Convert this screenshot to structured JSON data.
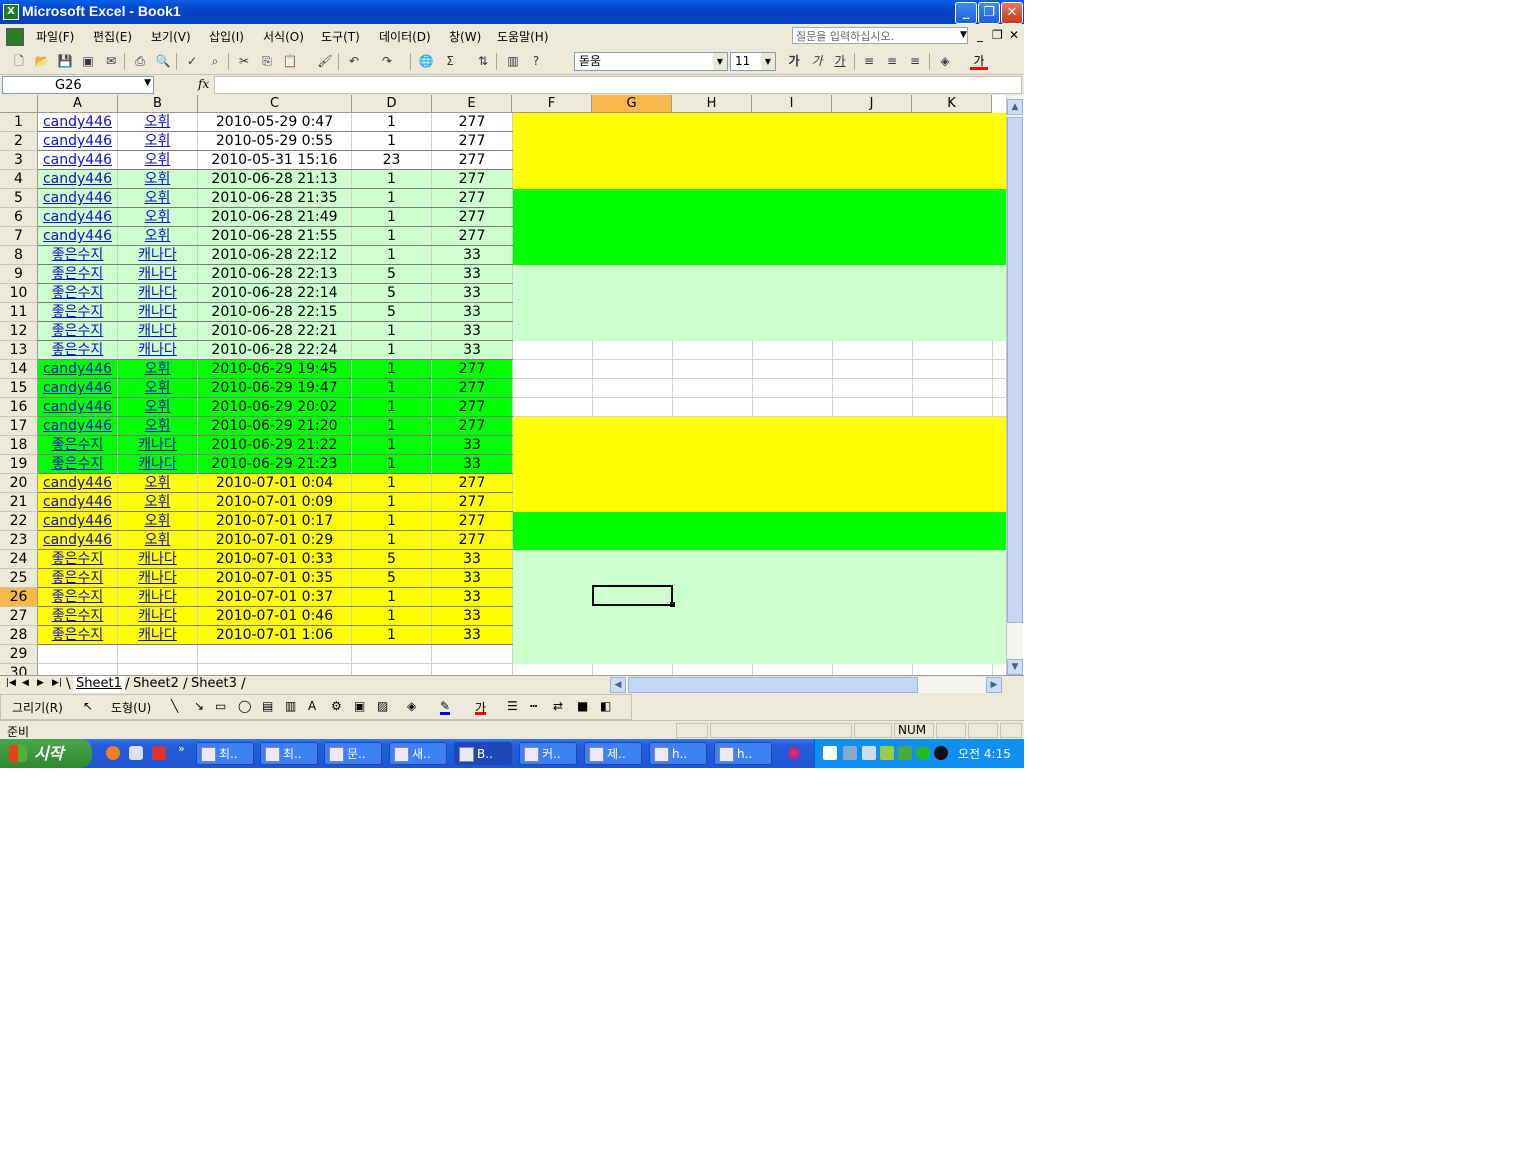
{
  "window": {
    "title": "Microsoft Excel - Book1"
  },
  "menu": {
    "items": [
      "파일(F)",
      "편집(E)",
      "보기(V)",
      "삽입(I)",
      "서식(O)",
      "도구(T)",
      "데이터(D)",
      "창(W)",
      "도움말(H)"
    ],
    "help_placeholder": "질문을 입력하십시오."
  },
  "format": {
    "font": "돋움",
    "size": "11",
    "bold": "가",
    "italic": "가",
    "underline": "가",
    "font_color": "가"
  },
  "formula_bar": {
    "name_box": "G26",
    "fx": "fx",
    "value": ""
  },
  "columns": [
    "A",
    "B",
    "C",
    "D",
    "E",
    "F",
    "G",
    "H",
    "I",
    "J",
    "K"
  ],
  "selected_column": "G",
  "selected_row": "26",
  "rows": [
    {
      "n": "1",
      "a": "candy446",
      "b": "오휘",
      "c": "2010-05-29 0:47",
      "d": "1",
      "e": "277"
    },
    {
      "n": "2",
      "a": "candy446",
      "b": "오휘",
      "c": "2010-05-29 0:55",
      "d": "1",
      "e": "277"
    },
    {
      "n": "3",
      "a": "candy446",
      "b": "오휘",
      "c": "2010-05-31 15:16",
      "d": "23",
      "e": "277"
    },
    {
      "n": "4",
      "a": "candy446",
      "b": "오휘",
      "c": "2010-06-28 21:13",
      "d": "1",
      "e": "277"
    },
    {
      "n": "5",
      "a": "candy446",
      "b": "오휘",
      "c": "2010-06-28 21:35",
      "d": "1",
      "e": "277"
    },
    {
      "n": "6",
      "a": "candy446",
      "b": "오휘",
      "c": "2010-06-28 21:49",
      "d": "1",
      "e": "277"
    },
    {
      "n": "7",
      "a": "candy446",
      "b": "오휘",
      "c": "2010-06-28 21:55",
      "d": "1",
      "e": "277"
    },
    {
      "n": "8",
      "a": "좋은수지",
      "b": "캐나다",
      "c": "2010-06-28 22:12",
      "d": "1",
      "e": "33"
    },
    {
      "n": "9",
      "a": "좋은수지",
      "b": "캐나다",
      "c": "2010-06-28 22:13",
      "d": "5",
      "e": "33"
    },
    {
      "n": "10",
      "a": "좋은수지",
      "b": "캐나다",
      "c": "2010-06-28 22:14",
      "d": "5",
      "e": "33"
    },
    {
      "n": "11",
      "a": "좋은수지",
      "b": "캐나다",
      "c": "2010-06-28 22:15",
      "d": "5",
      "e": "33"
    },
    {
      "n": "12",
      "a": "좋은수지",
      "b": "캐나다",
      "c": "2010-06-28 22:21",
      "d": "1",
      "e": "33"
    },
    {
      "n": "13",
      "a": "좋은수지",
      "b": "캐나다",
      "c": "2010-06-28 22:24",
      "d": "1",
      "e": "33"
    },
    {
      "n": "14",
      "a": "candy446",
      "b": "오휘",
      "c": "2010-06-29 19:45",
      "d": "1",
      "e": "277"
    },
    {
      "n": "15",
      "a": "candy446",
      "b": "오휘",
      "c": "2010-06-29 19:47",
      "d": "1",
      "e": "277"
    },
    {
      "n": "16",
      "a": "candy446",
      "b": "오휘",
      "c": "2010-06-29 20:02",
      "d": "1",
      "e": "277"
    },
    {
      "n": "17",
      "a": "candy446",
      "b": "오휘",
      "c": "2010-06-29 21:20",
      "d": "1",
      "e": "277"
    },
    {
      "n": "18",
      "a": "좋은수지",
      "b": "캐나다",
      "c": "2010-06-29 21:22",
      "d": "1",
      "e": "33"
    },
    {
      "n": "19",
      "a": "좋은수지",
      "b": "캐나다",
      "c": "2010-06-29 21:23",
      "d": "1",
      "e": "33"
    },
    {
      "n": "20",
      "a": "candy446",
      "b": "오휘",
      "c": "2010-07-01 0:04",
      "d": "1",
      "e": "277"
    },
    {
      "n": "21",
      "a": "candy446",
      "b": "오휘",
      "c": "2010-07-01 0:09",
      "d": "1",
      "e": "277"
    },
    {
      "n": "22",
      "a": "candy446",
      "b": "오휘",
      "c": "2010-07-01 0:17",
      "d": "1",
      "e": "277"
    },
    {
      "n": "23",
      "a": "candy446",
      "b": "오휘",
      "c": "2010-07-01 0:29",
      "d": "1",
      "e": "277"
    },
    {
      "n": "24",
      "a": "좋은수지",
      "b": "캐나다",
      "c": "2010-07-01 0:33",
      "d": "5",
      "e": "33"
    },
    {
      "n": "25",
      "a": "좋은수지",
      "b": "캐나다",
      "c": "2010-07-01 0:35",
      "d": "5",
      "e": "33"
    },
    {
      "n": "26",
      "a": "좋은수지",
      "b": "캐나다",
      "c": "2010-07-01 0:37",
      "d": "1",
      "e": "33"
    },
    {
      "n": "27",
      "a": "좋은수지",
      "b": "캐나다",
      "c": "2010-07-01 0:46",
      "d": "1",
      "e": "33"
    },
    {
      "n": "28",
      "a": "좋은수지",
      "b": "캐나다",
      "c": "2010-07-01 1:06",
      "d": "1",
      "e": "33"
    },
    {
      "n": "29",
      "a": "",
      "b": "",
      "c": "",
      "d": "",
      "e": ""
    },
    {
      "n": "30",
      "a": "",
      "b": "",
      "c": "",
      "d": "",
      "e": ""
    }
  ],
  "colors": {
    "yellow": "#ffff00",
    "green": "#00ff00",
    "light_green": "#ccffcc",
    "white": "#ffffff",
    "link": "#1010c8",
    "selection_header": "#f8b94a"
  },
  "row_fill_AE": [
    "white",
    "white",
    "white",
    "light_green",
    "light_green",
    "light_green",
    "light_green",
    "light_green",
    "light_green",
    "light_green",
    "light_green",
    "light_green",
    "light_green",
    "green",
    "green",
    "green",
    "green",
    "green",
    "green",
    "yellow",
    "yellow",
    "yellow",
    "yellow",
    "yellow",
    "yellow",
    "yellow",
    "yellow",
    "yellow",
    "white",
    "white"
  ],
  "row_fill_FK": [
    "yellow",
    "yellow",
    "yellow",
    "yellow",
    "green",
    "green",
    "green",
    "green",
    "light_green",
    "light_green",
    "light_green",
    "light_green",
    "white",
    "white",
    "white",
    "white",
    "yellow",
    "yellow",
    "yellow",
    "yellow",
    "yellow",
    "green",
    "green",
    "light_green",
    "light_green",
    "light_green",
    "light_green",
    "light_green",
    "light_green",
    "white"
  ],
  "sheets": {
    "tabs": [
      "Sheet1",
      "Sheet2",
      "Sheet3"
    ],
    "active": "Sheet1"
  },
  "draw_toolbar": {
    "draw": "그리기(R)",
    "shapes": "도형(U)"
  },
  "status": {
    "ready": "준비",
    "num": "NUM"
  },
  "taskbar": {
    "start": "시작",
    "buttons": [
      "최..",
      "최..",
      "문..",
      "새..",
      "B..",
      "커..",
      "제..",
      "h..",
      "h.."
    ],
    "active_index": 4,
    "clock": "오전 4:15"
  }
}
